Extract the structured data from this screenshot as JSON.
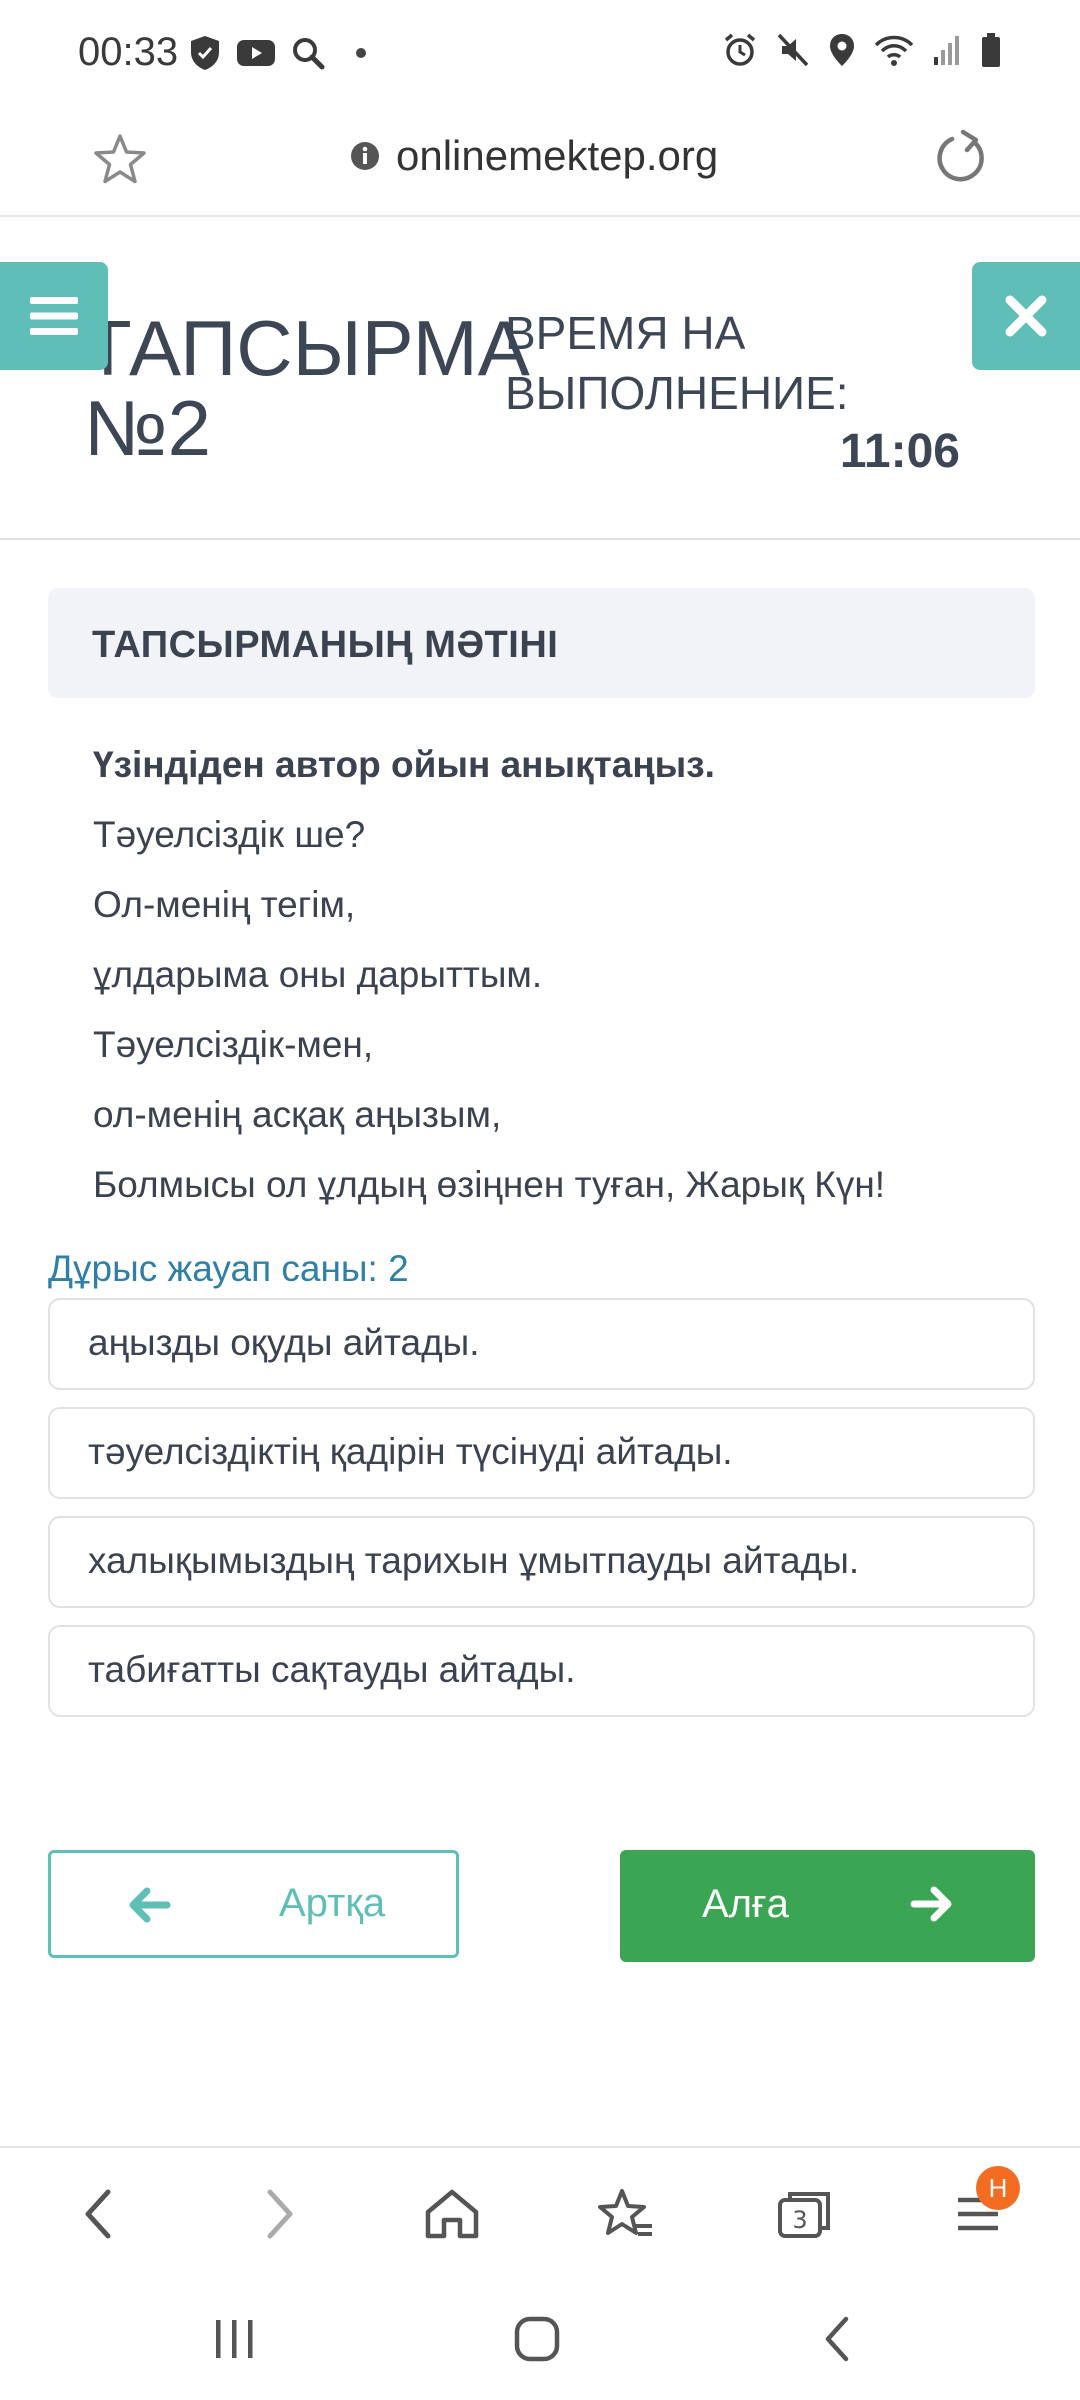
{
  "status_bar": {
    "time": "00:33",
    "left_icons": [
      "shield-icon",
      "youtube-icon",
      "search-icon",
      "dot-icon"
    ],
    "right_icons": [
      "alarm-icon",
      "mute-icon",
      "location-icon",
      "wifi-icon",
      "signal-icon",
      "battery-icon"
    ]
  },
  "browser": {
    "url": "onlinemektep.org",
    "toolbar_badge": "H",
    "tabs_count": "3"
  },
  "header": {
    "task_title": "ТАПСЫРМА",
    "task_number": "№2",
    "time_label_line1": "ВРЕМЯ НА",
    "time_label_line2": "ВЫПОЛНЕНИЕ:",
    "timer": "11:06"
  },
  "task": {
    "section_title": "ТАПСЫРМАНЫҢ МӘТІНІ",
    "question": "Үзіндіден автор ойын анықтаңыз.",
    "poem_lines": [
      "Тәуелсіздік ше?",
      "Ол-менің тегім,",
      "ұлдарыма оны дарыттым.",
      "Тәуелсіздік-мен,",
      "ол-менің асқақ аңызым,",
      "Болмысы ол ұлдың өзіңнен туған, Жарық Күн!"
    ],
    "correct_answers_count": "Дұрыс жауап саны: 2"
  },
  "options": [
    "аңызды оқуды айтады.",
    "тәуелсіздіктің қадірін түсінуді айтады.",
    "халықымыздың тарихын ұмытпауды айтады.",
    "табиғатты сақтауды айтады."
  ],
  "navigation": {
    "back_label": "Артқа",
    "next_label": "Алға"
  },
  "colors": {
    "teal": "#5fbfb6",
    "green": "#3aa653",
    "link_blue": "#2f7fa8",
    "badge_orange": "#f36c21"
  }
}
